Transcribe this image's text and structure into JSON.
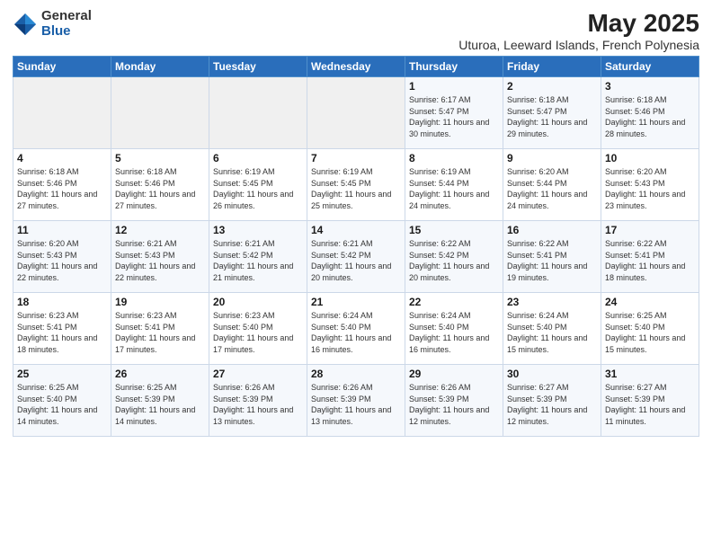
{
  "logo": {
    "general": "General",
    "blue": "Blue"
  },
  "header": {
    "title": "May 2025",
    "subtitle": "Uturoa, Leeward Islands, French Polynesia"
  },
  "days_of_week": [
    "Sunday",
    "Monday",
    "Tuesday",
    "Wednesday",
    "Thursday",
    "Friday",
    "Saturday"
  ],
  "weeks": [
    [
      {
        "day": "",
        "info": ""
      },
      {
        "day": "",
        "info": ""
      },
      {
        "day": "",
        "info": ""
      },
      {
        "day": "",
        "info": ""
      },
      {
        "day": "1",
        "info": "Sunrise: 6:17 AM\nSunset: 5:47 PM\nDaylight: 11 hours\nand 30 minutes."
      },
      {
        "day": "2",
        "info": "Sunrise: 6:18 AM\nSunset: 5:47 PM\nDaylight: 11 hours\nand 29 minutes."
      },
      {
        "day": "3",
        "info": "Sunrise: 6:18 AM\nSunset: 5:46 PM\nDaylight: 11 hours\nand 28 minutes."
      }
    ],
    [
      {
        "day": "4",
        "info": "Sunrise: 6:18 AM\nSunset: 5:46 PM\nDaylight: 11 hours\nand 27 minutes."
      },
      {
        "day": "5",
        "info": "Sunrise: 6:18 AM\nSunset: 5:46 PM\nDaylight: 11 hours\nand 27 minutes."
      },
      {
        "day": "6",
        "info": "Sunrise: 6:19 AM\nSunset: 5:45 PM\nDaylight: 11 hours\nand 26 minutes."
      },
      {
        "day": "7",
        "info": "Sunrise: 6:19 AM\nSunset: 5:45 PM\nDaylight: 11 hours\nand 25 minutes."
      },
      {
        "day": "8",
        "info": "Sunrise: 6:19 AM\nSunset: 5:44 PM\nDaylight: 11 hours\nand 24 minutes."
      },
      {
        "day": "9",
        "info": "Sunrise: 6:20 AM\nSunset: 5:44 PM\nDaylight: 11 hours\nand 24 minutes."
      },
      {
        "day": "10",
        "info": "Sunrise: 6:20 AM\nSunset: 5:43 PM\nDaylight: 11 hours\nand 23 minutes."
      }
    ],
    [
      {
        "day": "11",
        "info": "Sunrise: 6:20 AM\nSunset: 5:43 PM\nDaylight: 11 hours\nand 22 minutes."
      },
      {
        "day": "12",
        "info": "Sunrise: 6:21 AM\nSunset: 5:43 PM\nDaylight: 11 hours\nand 22 minutes."
      },
      {
        "day": "13",
        "info": "Sunrise: 6:21 AM\nSunset: 5:42 PM\nDaylight: 11 hours\nand 21 minutes."
      },
      {
        "day": "14",
        "info": "Sunrise: 6:21 AM\nSunset: 5:42 PM\nDaylight: 11 hours\nand 20 minutes."
      },
      {
        "day": "15",
        "info": "Sunrise: 6:22 AM\nSunset: 5:42 PM\nDaylight: 11 hours\nand 20 minutes."
      },
      {
        "day": "16",
        "info": "Sunrise: 6:22 AM\nSunset: 5:41 PM\nDaylight: 11 hours\nand 19 minutes."
      },
      {
        "day": "17",
        "info": "Sunrise: 6:22 AM\nSunset: 5:41 PM\nDaylight: 11 hours\nand 18 minutes."
      }
    ],
    [
      {
        "day": "18",
        "info": "Sunrise: 6:23 AM\nSunset: 5:41 PM\nDaylight: 11 hours\nand 18 minutes."
      },
      {
        "day": "19",
        "info": "Sunrise: 6:23 AM\nSunset: 5:41 PM\nDaylight: 11 hours\nand 17 minutes."
      },
      {
        "day": "20",
        "info": "Sunrise: 6:23 AM\nSunset: 5:40 PM\nDaylight: 11 hours\nand 17 minutes."
      },
      {
        "day": "21",
        "info": "Sunrise: 6:24 AM\nSunset: 5:40 PM\nDaylight: 11 hours\nand 16 minutes."
      },
      {
        "day": "22",
        "info": "Sunrise: 6:24 AM\nSunset: 5:40 PM\nDaylight: 11 hours\nand 16 minutes."
      },
      {
        "day": "23",
        "info": "Sunrise: 6:24 AM\nSunset: 5:40 PM\nDaylight: 11 hours\nand 15 minutes."
      },
      {
        "day": "24",
        "info": "Sunrise: 6:25 AM\nSunset: 5:40 PM\nDaylight: 11 hours\nand 15 minutes."
      }
    ],
    [
      {
        "day": "25",
        "info": "Sunrise: 6:25 AM\nSunset: 5:40 PM\nDaylight: 11 hours\nand 14 minutes."
      },
      {
        "day": "26",
        "info": "Sunrise: 6:25 AM\nSunset: 5:39 PM\nDaylight: 11 hours\nand 14 minutes."
      },
      {
        "day": "27",
        "info": "Sunrise: 6:26 AM\nSunset: 5:39 PM\nDaylight: 11 hours\nand 13 minutes."
      },
      {
        "day": "28",
        "info": "Sunrise: 6:26 AM\nSunset: 5:39 PM\nDaylight: 11 hours\nand 13 minutes."
      },
      {
        "day": "29",
        "info": "Sunrise: 6:26 AM\nSunset: 5:39 PM\nDaylight: 11 hours\nand 12 minutes."
      },
      {
        "day": "30",
        "info": "Sunrise: 6:27 AM\nSunset: 5:39 PM\nDaylight: 11 hours\nand 12 minutes."
      },
      {
        "day": "31",
        "info": "Sunrise: 6:27 AM\nSunset: 5:39 PM\nDaylight: 11 hours\nand 11 minutes."
      }
    ]
  ]
}
